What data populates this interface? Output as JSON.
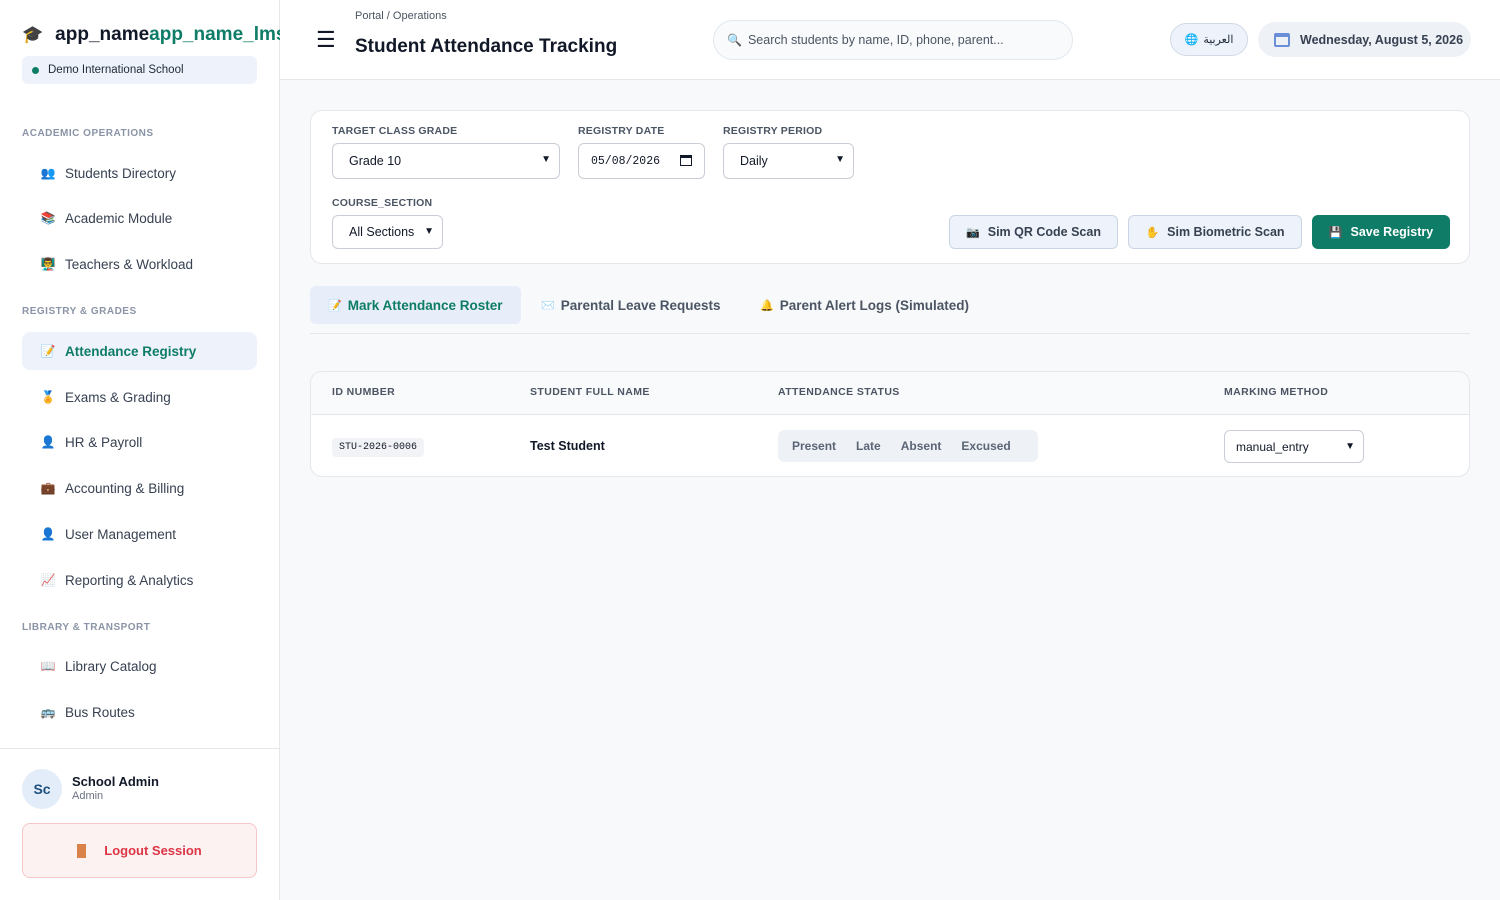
{
  "brand": {
    "name_a": "app_name",
    "name_b": "app_name_lms",
    "school": "Demo International School"
  },
  "sidebar": {
    "sections": [
      {
        "label": "ACADEMIC OPERATIONS"
      },
      {
        "label": "REGISTRY & GRADES"
      },
      {
        "label": "LIBRARY & TRANSPORT"
      }
    ],
    "items": [
      {
        "label": "Students Directory",
        "icon": "users-icon"
      },
      {
        "label": "Academic Module",
        "icon": "books-icon"
      },
      {
        "label": "Teachers & Workload",
        "icon": "teacher-icon"
      },
      {
        "label": "Attendance Registry",
        "icon": "memo-icon",
        "active": true
      },
      {
        "label": "Exams & Grading",
        "icon": "medal-icon"
      },
      {
        "label": "HR & Payroll",
        "icon": "person-icon"
      },
      {
        "label": "Accounting & Billing",
        "icon": "briefcase-icon"
      },
      {
        "label": "User Management",
        "icon": "user-icon"
      },
      {
        "label": "Reporting & Analytics",
        "icon": "chart-icon"
      },
      {
        "label": "Library Catalog",
        "icon": "book-icon"
      },
      {
        "label": "Bus Routes",
        "icon": "bus-icon"
      }
    ]
  },
  "user": {
    "initials": "Sc",
    "name": "School Admin",
    "role": "Admin",
    "logout_label": "Logout Session"
  },
  "header": {
    "breadcrumb": "Portal / Operations",
    "title": "Student Attendance Tracking",
    "search_placeholder": "Search students by name, ID, phone, parent...",
    "language_label": "العربية",
    "date": "Wednesday, August 5, 2026"
  },
  "filters": {
    "grade_label": "TARGET CLASS GRADE",
    "grade_value": "Grade 10",
    "date_label": "REGISTRY DATE",
    "date_value": "05/08/2026",
    "period_label": "REGISTRY PERIOD",
    "period_value": "Daily",
    "section_label": "COURSE_SECTION",
    "section_value": "All Sections",
    "qr_label": "Sim QR Code Scan",
    "bio_label": "Sim Biometric Scan",
    "save_label": "Save Registry"
  },
  "tabs": [
    {
      "label": "Mark Attendance Roster",
      "active": true
    },
    {
      "label": "Parental Leave Requests"
    },
    {
      "label": "Parent Alert Logs (Simulated)"
    }
  ],
  "table": {
    "columns": [
      "ID NUMBER",
      "STUDENT FULL NAME",
      "ATTENDANCE STATUS",
      "MARKING METHOD"
    ],
    "rows": [
      {
        "id": "STU-2026-0006",
        "name": "Test Student",
        "method": "manual_entry"
      }
    ],
    "status_options": [
      "Present",
      "Late",
      "Absent",
      "Excused"
    ]
  },
  "colors": {
    "accent": "#0e7c66",
    "danger": "#dc3545"
  }
}
